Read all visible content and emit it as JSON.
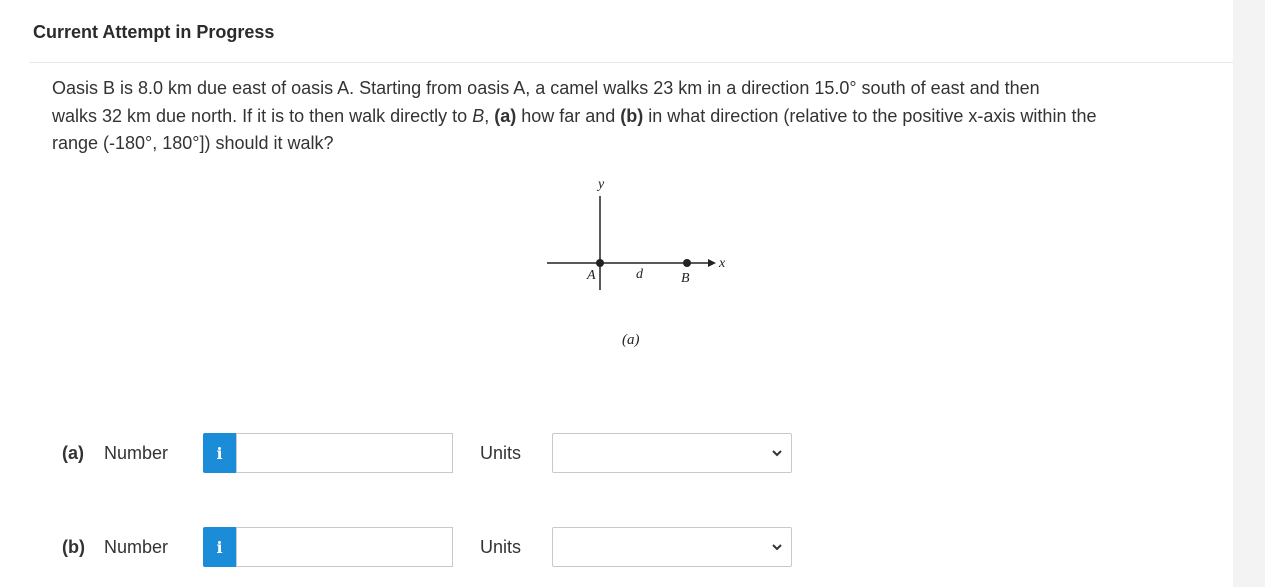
{
  "header": {
    "title": "Current Attempt in Progress"
  },
  "question": {
    "line1": "Oasis B is 8.0 km due east of oasis A. Starting from oasis A, a camel walks 23 km in a direction 15.0° south of east and then",
    "line2_pre": "walks 32 km due north. If it is to then walk directly to ",
    "line2_B": "B",
    "line2_mid": ", ",
    "line2_a": "(a)",
    "line2_mid2": " how far and ",
    "line2_b": "(b)",
    "line2_post": " in what direction (relative to the positive x-axis within the",
    "line3": "range (-180°, 180°]) should it walk?"
  },
  "figure": {
    "y_label": "y",
    "x_label": "x",
    "point_a": "A",
    "point_b": "B",
    "distance_label": "d",
    "caption": "(a)"
  },
  "answers": [
    {
      "part": "(a)",
      "number_label": "Number",
      "info_icon": "i",
      "value": "",
      "units_label": "Units",
      "units_selected": ""
    },
    {
      "part": "(b)",
      "number_label": "Number",
      "info_icon": "i",
      "value": "",
      "units_label": "Units",
      "units_selected": ""
    }
  ],
  "colors": {
    "info_button": "#1a8cd8",
    "border": "#c9c9c9"
  }
}
